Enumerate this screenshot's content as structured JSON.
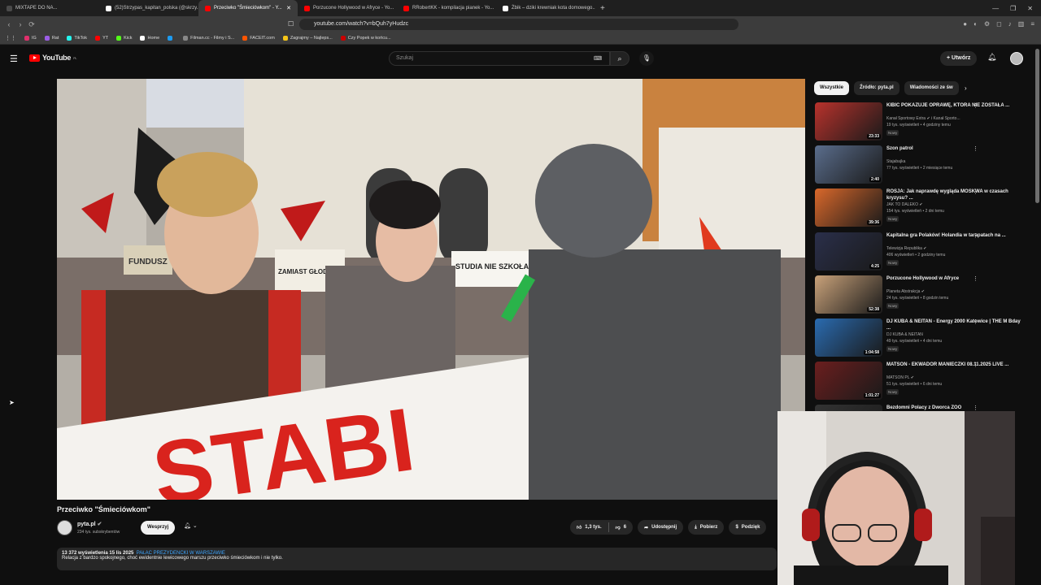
{
  "browser": {
    "tabs": [
      {
        "label": "MIXTAPE DO NA...",
        "color": "#4a4a4a",
        "active": false
      },
      {
        "label": "(52)Strzypas_kapitan_polska (@skrzy...",
        "color": "#ffffff",
        "active": false
      },
      {
        "label": "Przeciwko \"Śmieciówkom\" - Y...",
        "color": "#ff0000",
        "active": true
      },
      {
        "label": "Porzucone Hollywood w Afryce - Yo...",
        "color": "#ff0000",
        "active": false
      },
      {
        "label": "RRobertKK - kompilacja pianek - Yo...",
        "color": "#ff0000",
        "active": false
      },
      {
        "label": "Żbik – dziki krewniak kota domowego...",
        "color": "#ffffff",
        "active": false
      }
    ],
    "url": "youtube.com/watch?v=bQuh7yHudzc",
    "bookmarks": [
      {
        "label": "IG",
        "color": "#e1306c"
      },
      {
        "label": "Rat",
        "color": "#9b5de5"
      },
      {
        "label": "TikTok",
        "color": "#25f4ee"
      },
      {
        "label": "YT",
        "color": "#ff0000"
      },
      {
        "label": "Kick",
        "color": "#53fc18"
      },
      {
        "label": "Home",
        "color": "#ffffff"
      },
      {
        "label": "",
        "color": "#1d9bf0"
      },
      {
        "label": "Filman.cc - Filmy i S...",
        "color": "#888888"
      },
      {
        "label": "FACEIT.com",
        "color": "#ff5500"
      },
      {
        "label": "Zagrajmy – Najleps...",
        "color": "#f5c518"
      },
      {
        "label": "Czy Popek w końcu...",
        "color": "#cc0000"
      }
    ]
  },
  "youtube": {
    "logo_text": "YouTube",
    "logo_region": "PL",
    "search_placeholder": "Szukaj",
    "create_label": "Utwórz"
  },
  "video": {
    "title": "Przeciwko \"Śmieciówkom\"",
    "channel": "pyta.pl",
    "subscribers": "234 tys. subskrybentów",
    "support_label": "Wesprzyj",
    "likes": "1,3 tys.",
    "dislikes": "6",
    "share_label": "Udostępnij",
    "download_label": "Pobierz",
    "thanks_label": "Podzięk",
    "stats": "13 372 wyświetlenia  15 lis 2025",
    "hashtag": "PAŁAC PREZYDENCKI W WARSZAWIE",
    "description": "Relacja z bardzo spokojnego, choć ewidentnie lewicowego marszu przeciwko śmieciówkom i nie tylko."
  },
  "chips": [
    "Wszystkie",
    "Źródło: pyta.pl",
    "Wiadomości ze św"
  ],
  "recommendations": [
    {
      "title": "KIBIC POKAZUJE OPRAWĘ, KTÓRA NIE ZOSTAŁA ...",
      "channel": "Kanał Sportowy Extra ✔ i Kanał Sporto...",
      "meta": "19 tys. wyświetleń • 4 godziny temu",
      "new": "Nowy",
      "duration": "23:33",
      "color": "#b8322c"
    },
    {
      "title": "Szon patrol",
      "channel": "Stajabajka",
      "meta": "77 tys. wyświetleń • 2 miesiące temu",
      "new": "",
      "duration": "2:40",
      "color": "#5a6d8c"
    },
    {
      "title": "ROSJA: Jak naprawdę wygląda MOSKWA w czasach kryzysu? ...",
      "channel": "JAK TO DALEKO ✔",
      "meta": "154 tys. wyświetleń • 2 dni temu",
      "new": "Nowy",
      "duration": "39:36",
      "color": "#d9682b"
    },
    {
      "title": "Kapitalna gra Polaków! Holandia w tarapatach na ...",
      "channel": "Telewizja Republika ✔",
      "meta": "406 wyświetleń • 2 godziny temu",
      "new": "Nowy",
      "duration": "4:25",
      "color": "#2a2f4a"
    },
    {
      "title": "Porzucone Hollywood w Afryce",
      "channel": "Planeta Abstrakcja ✔",
      "meta": "24 tys. wyświetleń • 8 godzin temu",
      "new": "Nowy",
      "duration": "52:38",
      "color": "#c9a27a"
    },
    {
      "title": "DJ KUBA & NEITAN - Energy 2000 Katowice | THE M Bday ...",
      "channel": "DJ KUBA & NEITAN",
      "meta": "49 tys. wyświetleń • 4 dni temu",
      "new": "Nowy",
      "duration": "1:04:58",
      "color": "#2a6bb0"
    },
    {
      "title": "MATSON - EKWADOR MANIECZKI 08.11.2025 LIVE ...",
      "channel": "MATSON PL ✔",
      "meta": "51 tys. wyświetleń • 6 dni temu",
      "new": "Nowy",
      "duration": "1:01:27",
      "color": "#6b1e1e"
    },
    {
      "title": "Bezdomni Polacy z Dworca ZOO",
      "channel": "",
      "meta": "",
      "new": "",
      "duration": "",
      "color": "#333333"
    }
  ],
  "video_scene": {
    "sign1": "FUNDUSZ",
    "sign2": "ZAMIAST GŁODOWEJ TANIE STOŁÓW",
    "sign3": "STUDIA NIE SZKOŁA DLA BOG",
    "banner": "STABI"
  }
}
